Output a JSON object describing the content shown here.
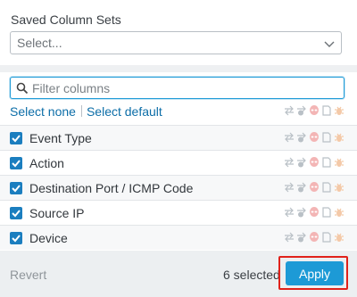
{
  "saved_column_sets": {
    "label": "Saved Column Sets",
    "placeholder": "Select..."
  },
  "filter": {
    "placeholder": "Filter columns",
    "value": ""
  },
  "links": {
    "select_none": "Select none",
    "select_default": "Select default"
  },
  "column_icons": [
    "arrows-exchange-icon",
    "info-exchange-icon",
    "alien-icon",
    "document-icon",
    "bug-icon"
  ],
  "columns": [
    {
      "label": "Event Type",
      "checked": true
    },
    {
      "label": "Action",
      "checked": true
    },
    {
      "label": "Destination Port / ICMP Code",
      "checked": true
    },
    {
      "label": "Source IP",
      "checked": true
    },
    {
      "label": "Device",
      "checked": true
    }
  ],
  "footer": {
    "revert": "Revert",
    "selected_count": "6 selected",
    "apply": "Apply"
  },
  "colors": {
    "accent": "#1d9ad6",
    "checkbox": "#1b7ebf",
    "link": "#0d6ea8",
    "highlight_outline": "#e0221b"
  }
}
